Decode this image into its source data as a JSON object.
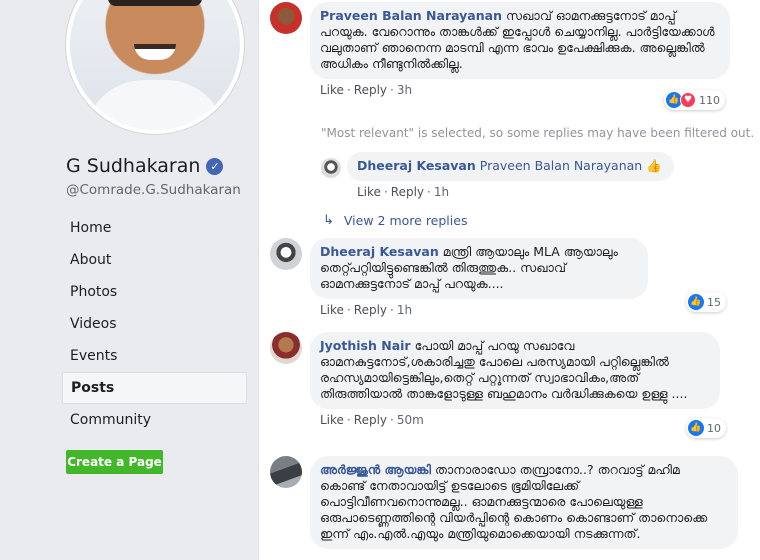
{
  "page": {
    "name": "G Sudhakaran",
    "handle": "@Comrade.G.Sudhakaran",
    "nav": [
      "Home",
      "About",
      "Photos",
      "Videos",
      "Events",
      "Posts",
      "Community"
    ],
    "active_nav": "Posts",
    "create_page": "Create a Page"
  },
  "comments": [
    {
      "author": "Praveen Balan Narayanan",
      "text": "സഖാവ് ഓമനക്കുട്ടനോട് മാപ്പ് പറയുക. വേറൊന്നും താങ്കൾക്ക് ഇപ്പോൾ ചെയ്യാനില്ല. പാർട്ടിയേക്കാൾ വലുതാണ് ഞാനെന്ന മാടമ്പി എന്ന ഭാവം ഉപേക്ഷിക്കുക. അല്ലെങ്കിൽ അധികം നീണ്ടുനിൽക്കില്ല.",
      "like": "Like",
      "reply": "Reply",
      "time": "3h",
      "reactions": "110"
    },
    {
      "author": "Dheeraj Kesavan",
      "text": "Praveen Balan Narayanan 👍",
      "like": "Like",
      "reply": "Reply",
      "time": "1h"
    },
    {
      "author": "Dheeraj Kesavan",
      "text": "മന്ത്രി ആയാലും MLA ആയാലും തെറ്റ്പറ്റിയിട്ടുണ്ടെങ്കിൽ തിരുത്തുക.. സഖാവ് ഓമനക്കുട്ടനോട് മാപ്പ് പറയുക....",
      "like": "Like",
      "reply": "Reply",
      "time": "1h",
      "reactions": "15"
    },
    {
      "author": "Jyothish Nair",
      "text": "പോയി മാപ്പ് പറയു സഖാവേ ഓമനകുട്ടനോട്,ശകാരിച്ചതു പോലെ പരസ്യമായി പറ്റില്ലെങ്കിൽ രഹസ്യമായിട്ടെങ്കിലും,തെറ്റ് പറ്റുന്നത് സ്വാഭാവികം,അത് തിരുത്തിയാൽ താങ്കളോടുള്ള ബഹുമാനം വർദ്ധിക്കുകയെ ഉള്ളു ....",
      "like": "Like",
      "reply": "Reply",
      "time": "50m",
      "reactions": "10"
    },
    {
      "author": "അർജ്ജുൻ ആയങ്കി",
      "text": "താനാരാഡോ തമ്പ്രാനോ..? തറവാട്ട് മഹിമ കൊണ്ട് നേതാവായിട്ട് ഉടലോടെ ഭൂമിയിലേക്ക് പൊട്ടിവീണവനൊന്നുമല്ല.. ഓമനക്കുട്ടന്മാരെ പോലെയുള്ള ഒരുപാടെണ്ണത്തിന്റെ വിയർപ്പിന്റെ കൊണം കൊണ്ടാണ് താനൊക്കെ ഇന്ന് എം.എൽ.എയും മന്ത്രിയുമൊക്കെയായി നടക്കുന്നത്."
    }
  ],
  "notice": "\"Most relevant\" is selected, so some replies may have been filtered out.",
  "more_replies": "View 2 more replies",
  "colors": {
    "link": "#385898",
    "bubble": "#f2f3f5",
    "green": "#42b72a",
    "like_blue": "#1877f2"
  }
}
